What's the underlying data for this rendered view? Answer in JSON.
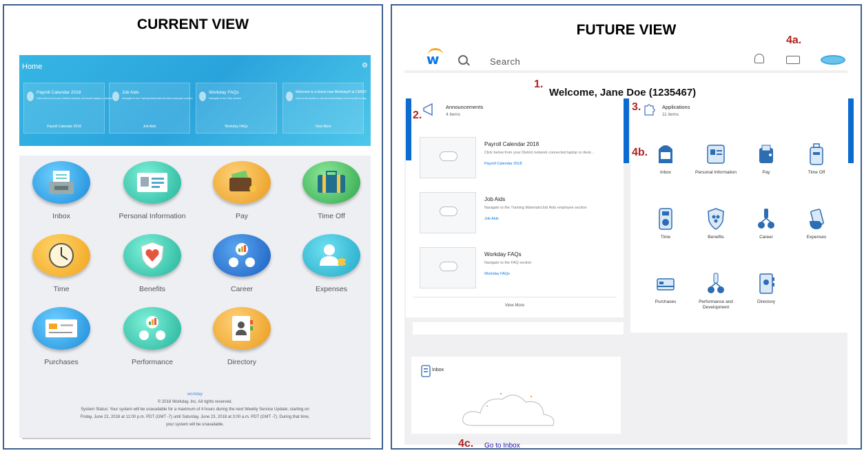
{
  "current": {
    "title": "CURRENT VIEW",
    "home_label": "Home",
    "cards": [
      {
        "title": "Payroll Calendar 2018",
        "desc": "Click below from your District network connected laptop or deskto...",
        "link": "Payroll Calendar 2018"
      },
      {
        "title": "Job Aids",
        "desc": "Navigate to the Training Materials\\Job Aids employee section",
        "link": "Job Aids"
      },
      {
        "title": "Workday FAQs",
        "desc": "Navigate to the FAQ section",
        "link": "Workday FAQs"
      },
      {
        "title": "Welcome to a brand new Workday® at CMSD!",
        "desc": "Click on the worklet, or use the search feature in the top left to navig...",
        "link": "View More"
      }
    ],
    "apps": [
      "Inbox",
      "Personal Information",
      "Pay",
      "Time Off",
      "Time",
      "Benefits",
      "Career",
      "Expenses",
      "Purchases",
      "Performance",
      "Directory"
    ],
    "footer_logo": "workday",
    "footer_copyright": "© 2018 Workday, Inc. All rights reserved.",
    "footer_status_1": "System Status: Your system will be unavailable for a maximum of 4 hours during the next Weekly Service Update; starting on",
    "footer_status_2": "Friday, June 22, 2018 at 11:00 p.m. PDT (GMT -7) until Saturday, June 23, 2018 at 3:00 a.m. PDT (GMT -7). During that time,",
    "footer_status_3": "your system will be unavailable."
  },
  "future": {
    "title": "FUTURE VIEW",
    "search_label": "Search",
    "markers": {
      "m1": "1.",
      "m2": "2.",
      "m3": "3.",
      "m4a": "4a.",
      "m4b": "4b.",
      "m4c": "4c."
    },
    "welcome": "Welcome, Jane Doe (1235467)",
    "announcements": {
      "title": "Announcements",
      "count": "4 items",
      "items": [
        {
          "title": "Payroll Calendar 2018",
          "desc": "Click below from your District network connected laptop or desk...",
          "link": "Payroll Calendar 2018"
        },
        {
          "title": "Job Aids",
          "desc": "Navigate to the Training Materials\\Job Aids employee section",
          "link": "Job Aids"
        },
        {
          "title": "Workday FAQs",
          "desc": "Navigate to the FAQ section",
          "link": "Workday FAQs"
        }
      ],
      "view_more": "View More"
    },
    "applications": {
      "title": "Applications",
      "count": "11 items",
      "apps": [
        "Inbox",
        "Personal Information",
        "Pay",
        "Time Off",
        "Time",
        "Benefits",
        "Career",
        "Expenses",
        "Purchases",
        "Performance and Development",
        "Directory"
      ]
    },
    "inbox_card": {
      "title": "Inbox",
      "link": "Go to Inbox"
    }
  },
  "colors": {
    "border": "#3b5f8f",
    "marker": "#b22222",
    "accent": "#0b6bd0"
  }
}
